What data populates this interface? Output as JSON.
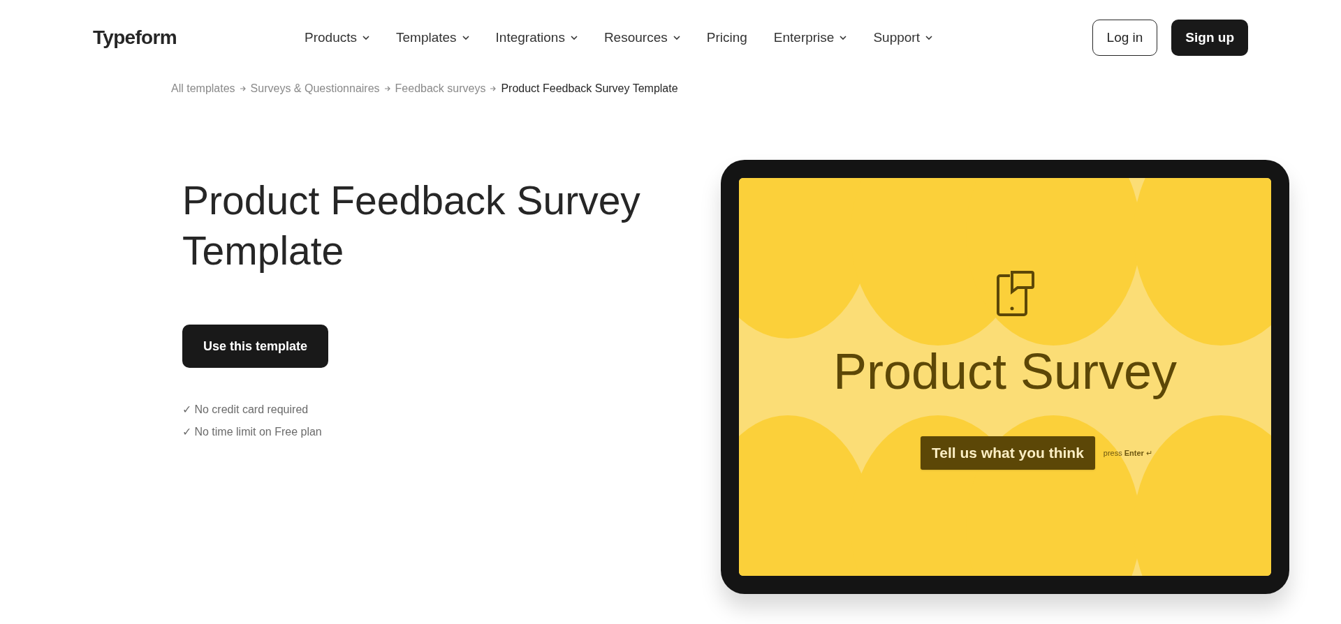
{
  "header": {
    "logo": "Typeform",
    "nav": [
      {
        "label": "Products",
        "dropdown": true
      },
      {
        "label": "Templates",
        "dropdown": true
      },
      {
        "label": "Integrations",
        "dropdown": true
      },
      {
        "label": "Resources",
        "dropdown": true
      },
      {
        "label": "Pricing",
        "dropdown": false
      },
      {
        "label": "Enterprise",
        "dropdown": true
      },
      {
        "label": "Support",
        "dropdown": true
      }
    ],
    "login": "Log in",
    "signup": "Sign up"
  },
  "breadcrumb": [
    {
      "label": "All templates",
      "current": false
    },
    {
      "label": "Surveys & Questionnaires",
      "current": false
    },
    {
      "label": "Feedback surveys",
      "current": false
    },
    {
      "label": "Product Feedback Survey Template",
      "current": true
    }
  ],
  "hero": {
    "title": "Product Feedback Survey Template",
    "cta": "Use this template",
    "notes": [
      "✓ No credit card required",
      "✓ No time limit on Free plan"
    ]
  },
  "preview": {
    "heading": "Product Survey",
    "button": "Tell us what you think",
    "hint": "press **Enter** ↵"
  }
}
